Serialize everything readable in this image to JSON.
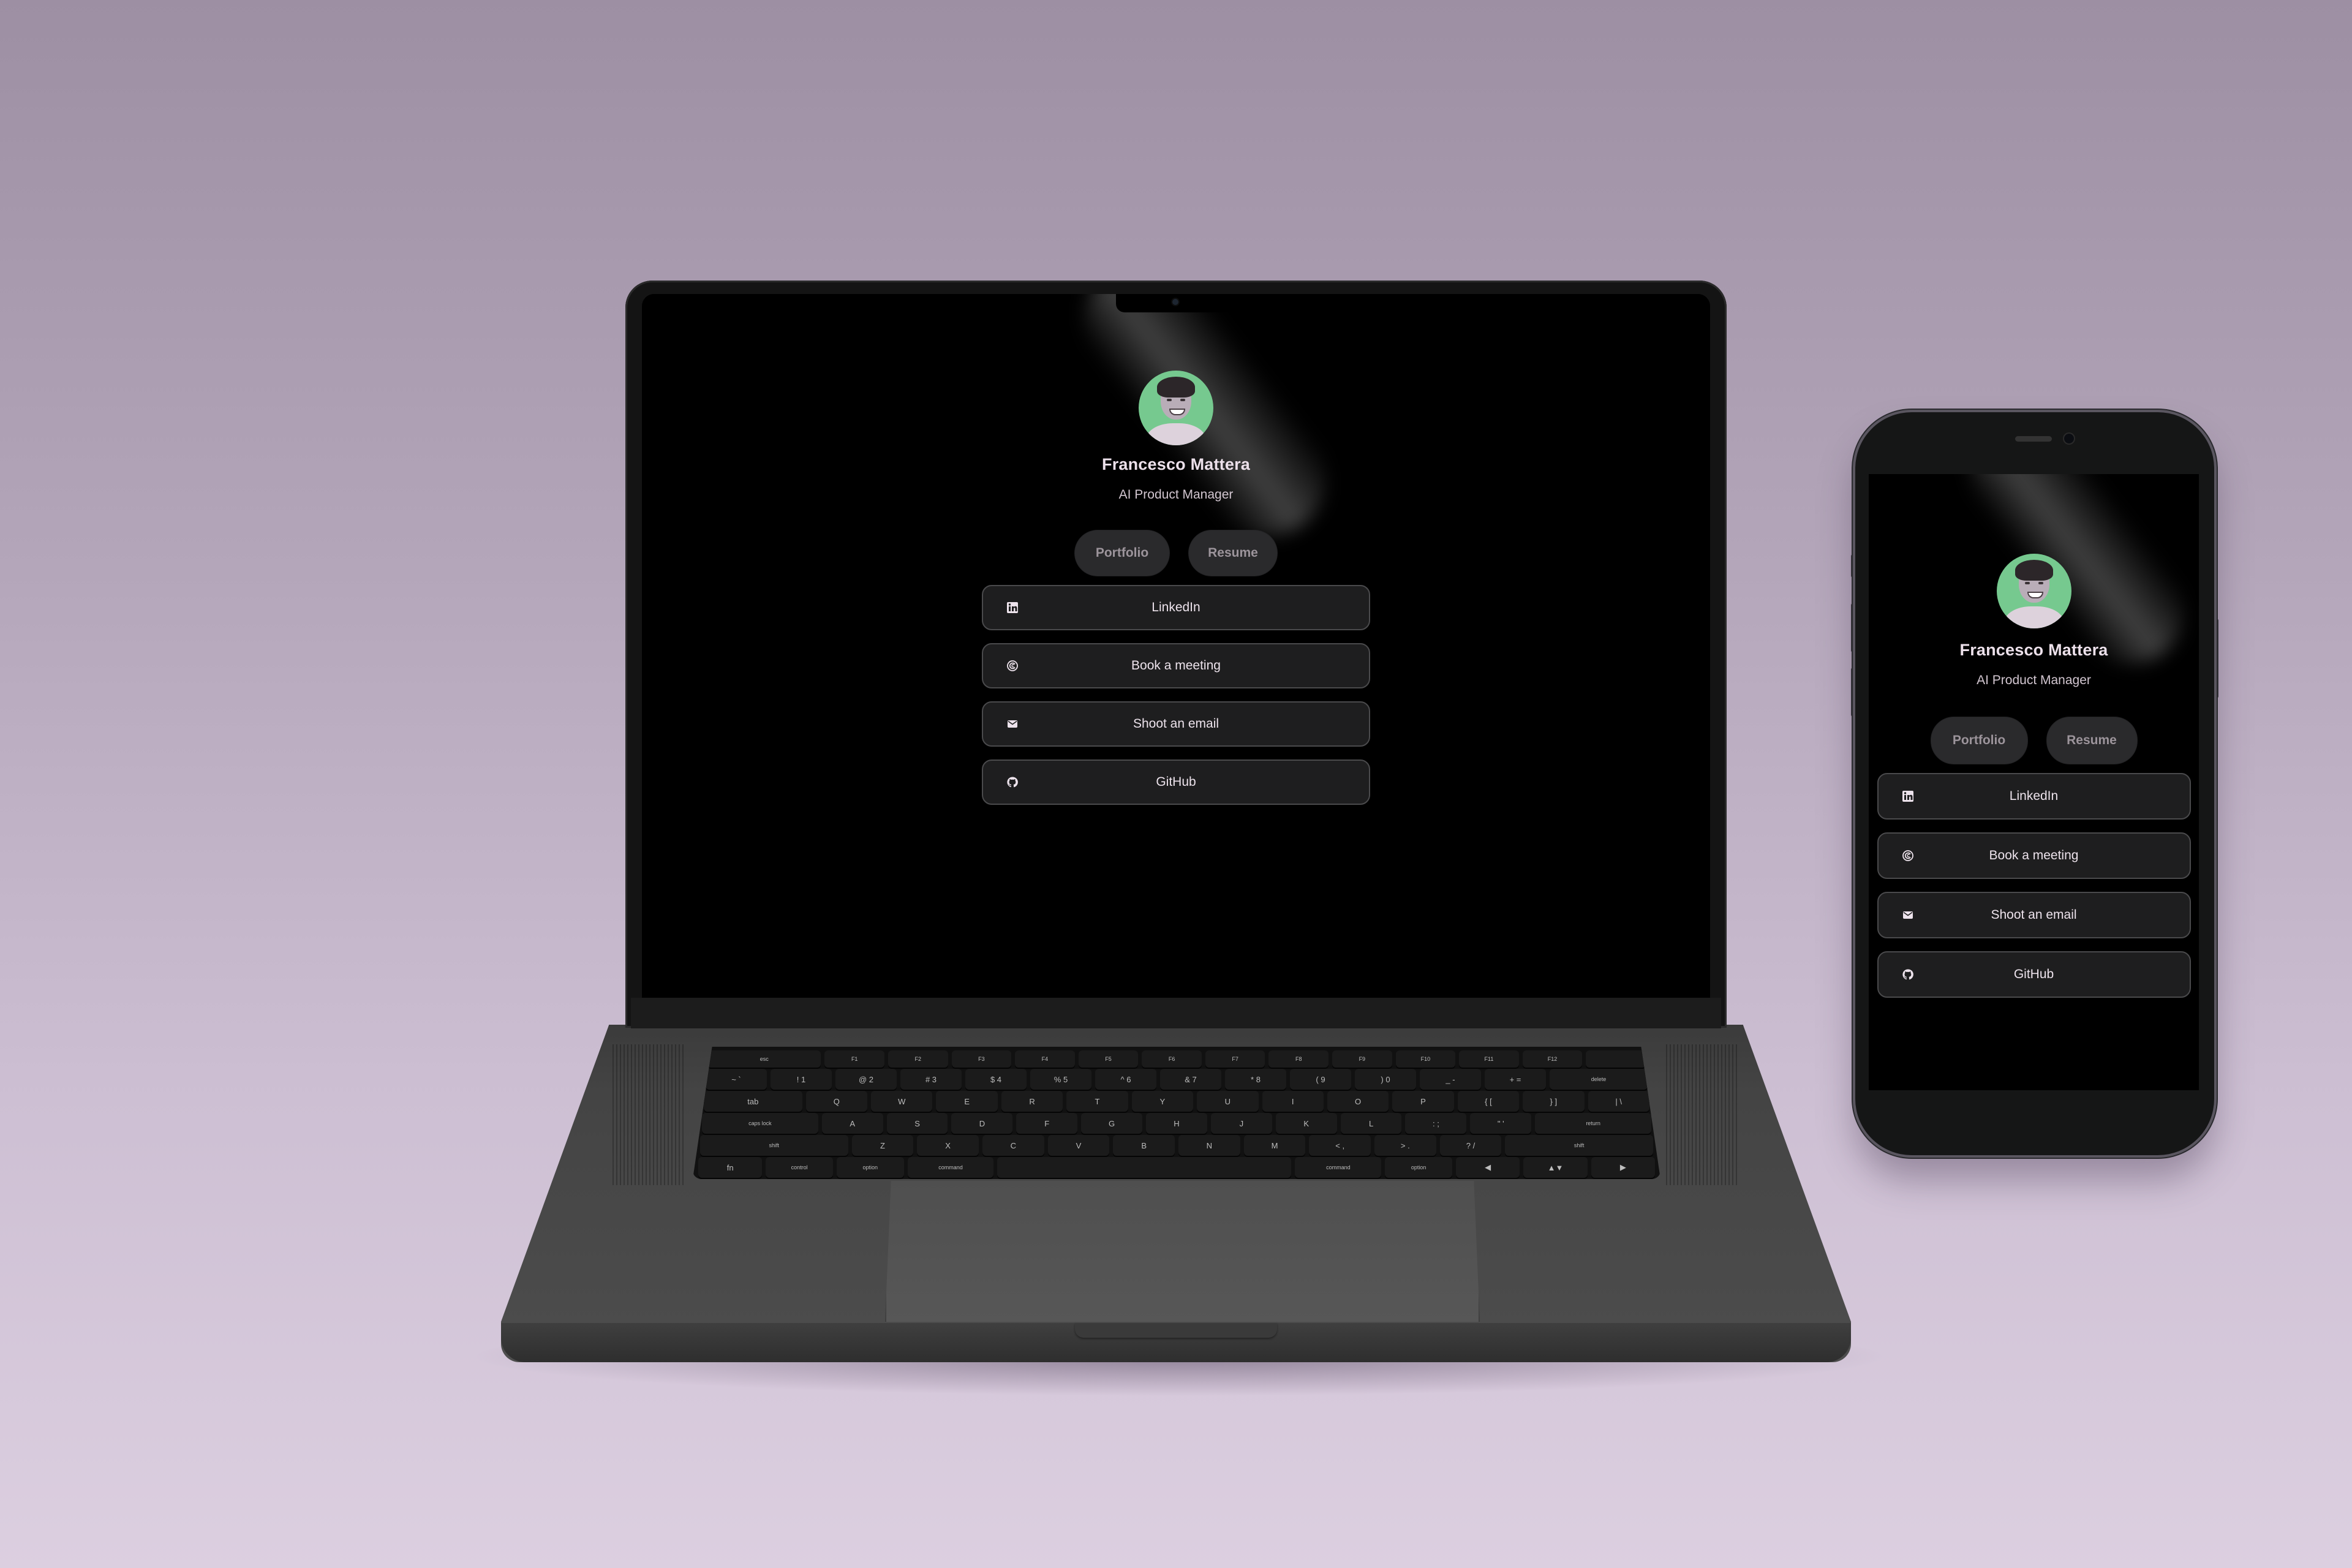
{
  "profile": {
    "name": "Francesco Mattera",
    "subtitle": "AI Product Manager",
    "avatar_bg": "#76c98f",
    "pills": [
      {
        "label": "Portfolio"
      },
      {
        "label": "Resume"
      }
    ],
    "links": [
      {
        "label": "LinkedIn",
        "icon": "linkedin-icon"
      },
      {
        "label": "Book a meeting",
        "icon": "calendly-icon"
      },
      {
        "label": "Shoot an email",
        "icon": "mail-icon"
      },
      {
        "label": "GitHub",
        "icon": "github-icon"
      }
    ]
  },
  "keyboard": {
    "rows": [
      [
        "esc",
        "F1",
        "F2",
        "F3",
        "F4",
        "F5",
        "F6",
        "F7",
        "F8",
        "F9",
        "F10",
        "F11",
        "F12",
        ""
      ],
      [
        "~ `",
        "! 1",
        "@ 2",
        "# 3",
        "$ 4",
        "% 5",
        "^ 6",
        "& 7",
        "* 8",
        "( 9",
        ") 0",
        "_ -",
        "+ =",
        "delete"
      ],
      [
        "tab",
        "Q",
        "W",
        "E",
        "R",
        "T",
        "Y",
        "U",
        "I",
        "O",
        "P",
        "{ [",
        "} ]",
        "| \\"
      ],
      [
        "caps lock",
        "A",
        "S",
        "D",
        "F",
        "G",
        "H",
        "J",
        "K",
        "L",
        ": ;",
        "\" '",
        "return"
      ],
      [
        "shift",
        "Z",
        "X",
        "C",
        "V",
        "B",
        "N",
        "M",
        "< ,",
        "> .",
        "? /",
        "shift"
      ],
      [
        "fn",
        "control",
        "option",
        "command",
        "",
        "command",
        "option",
        "◀",
        "▲▼",
        "▶"
      ]
    ]
  },
  "colors": {
    "background_top": "#9d8fa3",
    "background_bottom": "#dccfe0",
    "accent_green": "#76c98f",
    "button_bg": "#1e1e1f",
    "pill_bg": "#2a2a2c"
  }
}
